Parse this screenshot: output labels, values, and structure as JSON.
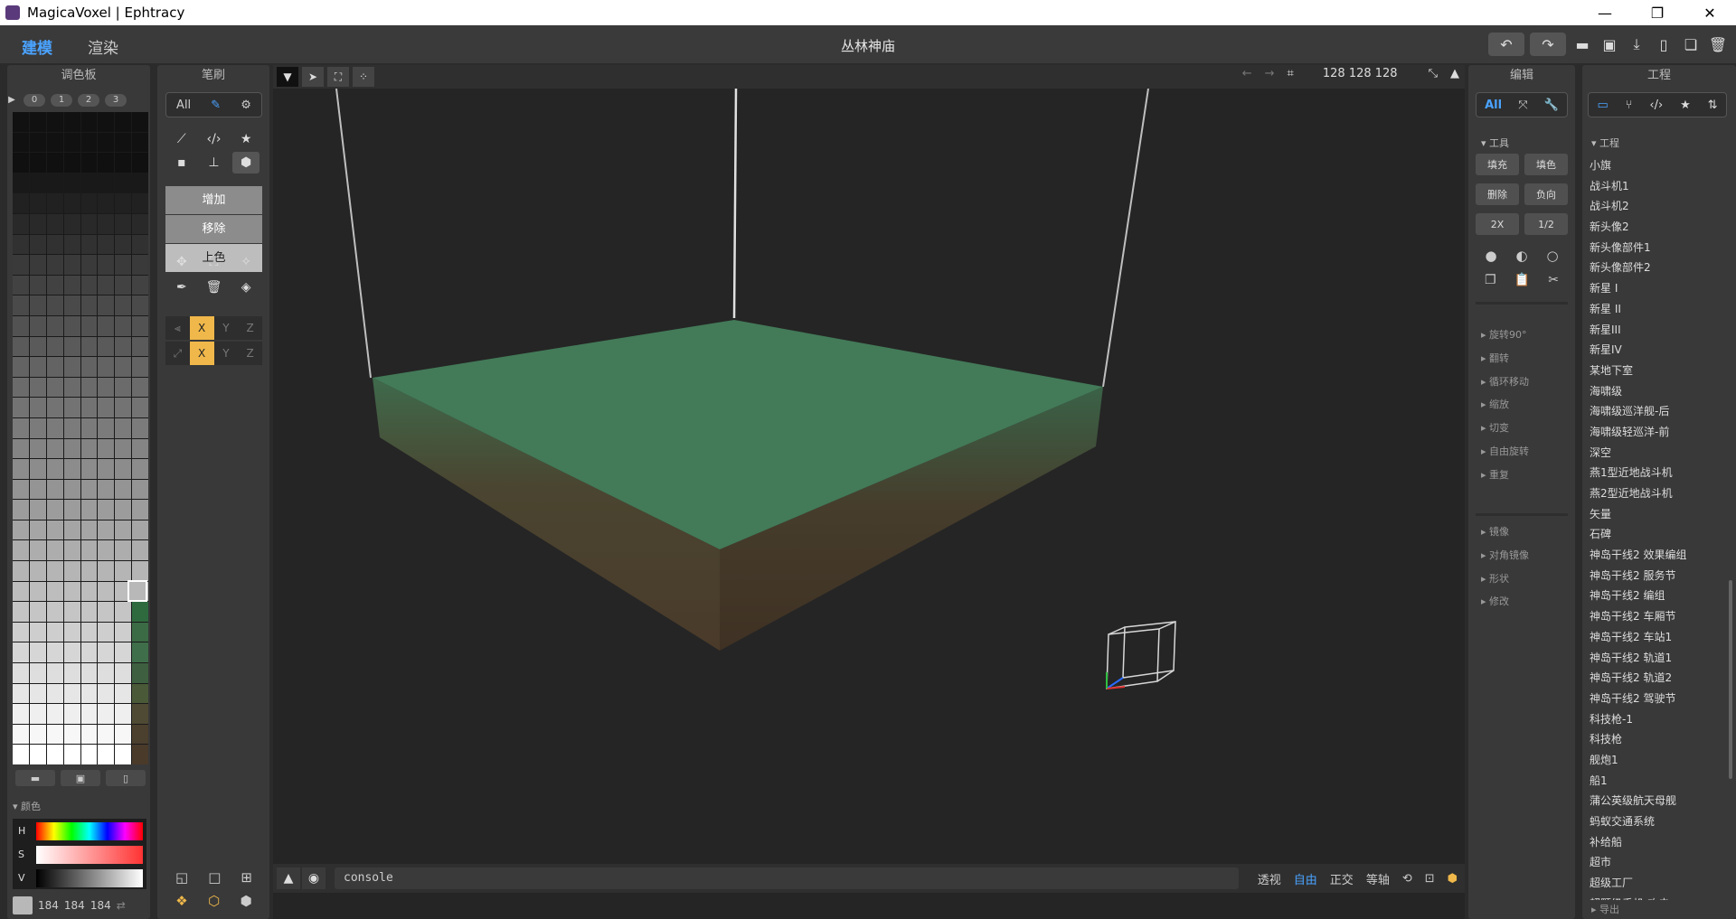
{
  "window": {
    "title": "MagicaVoxel | Ephtracy",
    "controls": [
      "—",
      "❐",
      "✕"
    ]
  },
  "topbar": {
    "mode_model": "建模",
    "mode_render": "渲染",
    "filename": "丛林神庙"
  },
  "palette": {
    "title": "调色板",
    "tabs": [
      "▶",
      "0",
      "1",
      "2",
      "3"
    ],
    "color_section": "颜色",
    "hsv": [
      "H",
      "S",
      "V"
    ],
    "rgb": {
      "r": "184",
      "g": "184",
      "b": "184"
    },
    "selected_color": "#b8b8b8"
  },
  "brush": {
    "title": "笔刷",
    "tab_all": "All",
    "modes": [
      "增加",
      "移除",
      "上色"
    ],
    "axis1": [
      "X",
      "Y",
      "Z"
    ],
    "axis2": [
      "X",
      "Y",
      "Z"
    ]
  },
  "viewport": {
    "dims": "128 128 128",
    "console": "console",
    "views": [
      "透视",
      "自由",
      "正交",
      "等轴"
    ],
    "active_view": "自由"
  },
  "edit": {
    "title": "编辑",
    "tab_all": "All",
    "tools_section": "工具",
    "buttons": [
      "填充",
      "填色",
      "删除",
      "负向",
      "2X",
      "1/2"
    ],
    "sections1": [
      "旋转90°",
      "翻转",
      "循环移动",
      "缩放",
      "切变",
      "自由旋转",
      "重复"
    ],
    "sections2": [
      "镜像",
      "对角镜像",
      "形状",
      "修改"
    ]
  },
  "project": {
    "title": "工程",
    "section": "工程",
    "export": "导出",
    "items": [
      "小旗",
      "战斗机1",
      "战斗机2",
      "新头像2",
      "新头像部件1",
      "新头像部件2",
      "新星 I",
      "新星 II",
      "新星III",
      "新星IV",
      "某地下室",
      "海啸级",
      "海啸级巡洋舰-后",
      "海啸级轻巡洋-前",
      "深空",
      "燕1型近地战斗机",
      "燕2型近地战斗机",
      "矢量",
      "石碑",
      "神岛干线2 效果编组",
      "神岛干线2 服务节",
      "神岛干线2 编组",
      "神岛干线2 车厢节",
      "神岛干线2 车站1",
      "神岛干线2 轨道1",
      "神岛干线2 轨道2",
      "神岛干线2 驾驶节",
      "科技枪-1",
      "科技枪",
      "舰炮1",
      "船1",
      "蒲公英级航天母舰",
      "蚂蚁交通系统",
      "补给船",
      "超市",
      "超级工厂",
      "超颗级手机-攻击"
    ]
  },
  "colors": {
    "accent": "#4aa3ff",
    "axis_on": "#f0b84a",
    "grass": "#437a58",
    "dirt": "#4b3a2b"
  }
}
